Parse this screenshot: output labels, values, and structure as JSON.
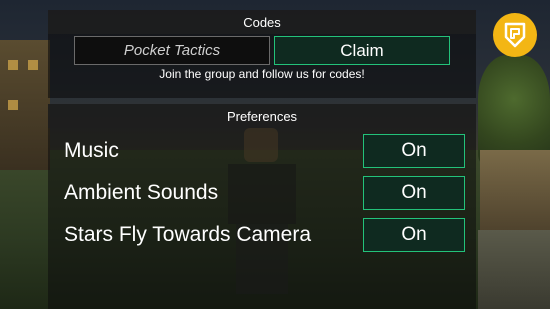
{
  "codes": {
    "header": "Codes",
    "input_placeholder": "Pocket Tactics",
    "claim_label": "Claim",
    "note": "Join the group and follow us for codes!"
  },
  "preferences": {
    "header": "Preferences",
    "items": [
      {
        "label": "Music",
        "state": "On"
      },
      {
        "label": "Ambient Sounds",
        "state": "On"
      },
      {
        "label": "Stars Fly Towards Camera",
        "state": "On"
      }
    ]
  },
  "colors": {
    "accent": "#23c27a",
    "button_bg": "#0f2a20",
    "badge": "#f3b614"
  },
  "icons": {
    "badge": "pocket-tactics-logo-icon"
  }
}
